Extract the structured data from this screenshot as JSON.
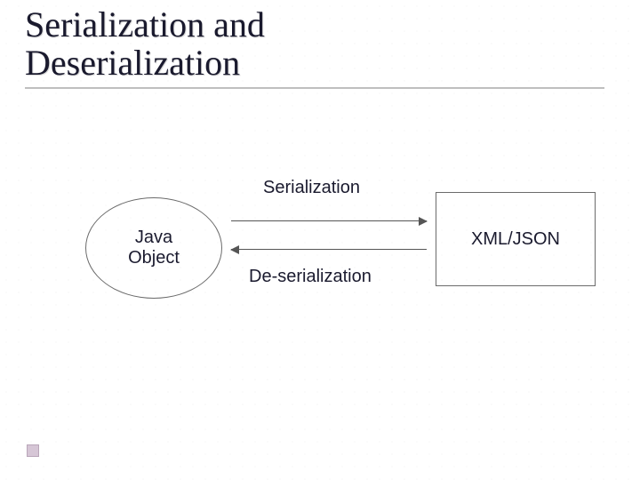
{
  "title": {
    "line1": "Serialization and",
    "line2": "Deserialization"
  },
  "diagram": {
    "left_node": "Java\nObject",
    "right_node": "XML/JSON",
    "top_label": "Serialization",
    "bottom_label": "De-serialization"
  }
}
